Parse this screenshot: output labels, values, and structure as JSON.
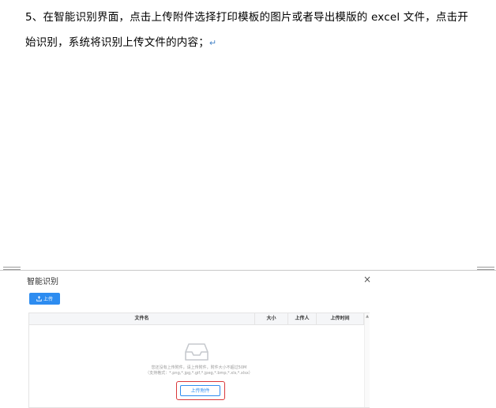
{
  "document": {
    "line1": "5、在智能识别界面，点击上传附件选择打印模板的图片或者导出模版的 excel 文件，点击开",
    "line2": "始识别，系统将识别上传文件的内容；",
    "paragraph_mark": "↵"
  },
  "dialog": {
    "title": "智能识别",
    "close_glyph": "×",
    "upload_button_label": "上传",
    "table": {
      "columns": [
        "文件名",
        "大小",
        "上传人",
        "上传时间"
      ]
    },
    "empty_state": {
      "line1": "您还没有上传附件，请上传附件，附件大小不超过50M",
      "line2": "（支持格式：*.png,*.jpg,*.gif,*.jpeg,*.bmp,*.xls,*.xlsx）",
      "attach_button_label": "上传附件"
    },
    "scroll_up_glyph": "▲"
  },
  "colors": {
    "primary": "#2d8cf0",
    "highlight": "#d9383a",
    "paragraph_mark": "#4a86c8"
  },
  "icons": [
    "upload-icon",
    "inbox-icon",
    "close-icon"
  ]
}
